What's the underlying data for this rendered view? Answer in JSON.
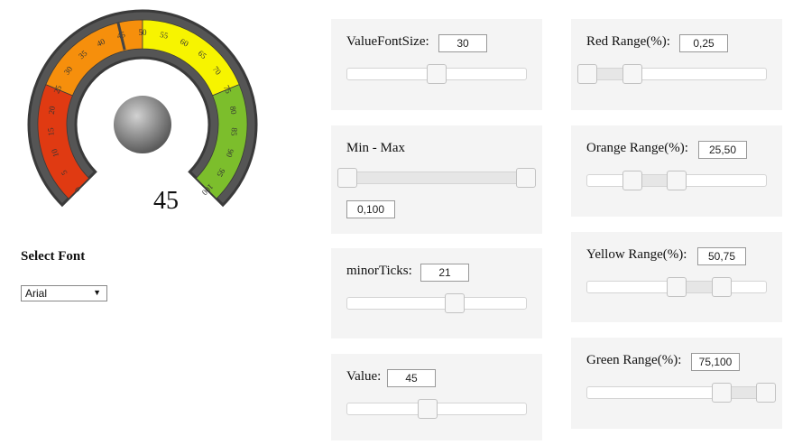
{
  "gauge": {
    "value": "45",
    "min": 0,
    "max": 100,
    "needle_value": 45,
    "tick_labels": [
      "0",
      "5",
      "10",
      "15",
      "20",
      "25",
      "30",
      "35",
      "40",
      "45",
      "50",
      "55",
      "60",
      "65",
      "70",
      "75",
      "80",
      "85",
      "90",
      "95",
      "100"
    ],
    "colors": {
      "red": "#e03a12",
      "orange": "#f68f0c",
      "yellow": "#f7f400",
      "green": "#7cbe2c",
      "frame": "#555555",
      "outline": "#3a3a3a"
    }
  },
  "font_selector": {
    "label": "Select Font",
    "selected": "Arial"
  },
  "controls": {
    "value_font_size": {
      "label": "ValueFontSize:",
      "value": "30",
      "slider": 0.5
    },
    "min_max": {
      "label": "Min - Max",
      "value": "0,100",
      "slider_low": 0,
      "slider_high": 1
    },
    "minor_ticks": {
      "label": "minorTicks:",
      "value": "21",
      "slider": 0.6
    },
    "value": {
      "label": "Value:",
      "value": "45",
      "slider": 0.45
    },
    "red_range": {
      "label": "Red Range(%):",
      "value": "0,25",
      "slider_low": 0,
      "slider_high": 0.25
    },
    "orange_range": {
      "label": "Orange Range(%):",
      "value": "25,50",
      "slider_low": 0.25,
      "slider_high": 0.5
    },
    "yellow_range": {
      "label": "Yellow Range(%):",
      "value": "50,75",
      "slider_low": 0.5,
      "slider_high": 0.75
    },
    "green_range": {
      "label": "Green Range(%):",
      "value": "75,100",
      "slider_low": 0.75,
      "slider_high": 1
    }
  }
}
